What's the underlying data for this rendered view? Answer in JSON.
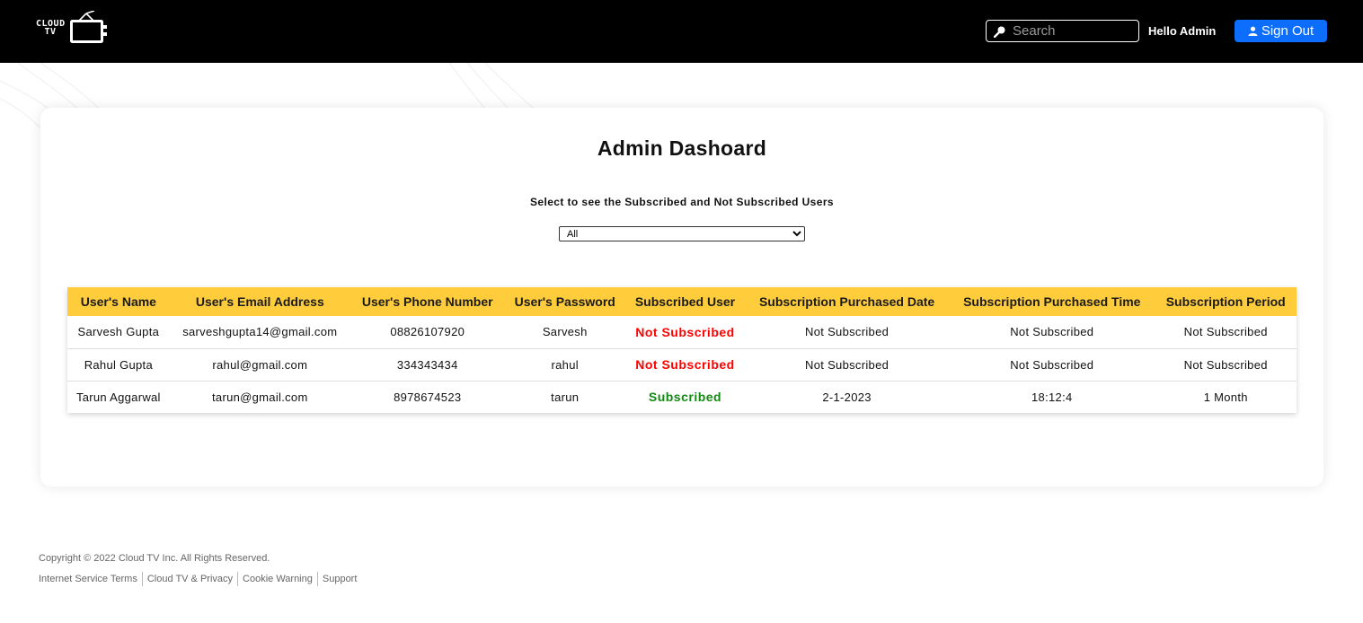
{
  "header": {
    "logo_text_top": "CLOUD",
    "logo_text_bottom": "TV",
    "search_placeholder": "Search",
    "greeting": "Hello Admin",
    "signout_label": "Sign Out"
  },
  "main": {
    "title": "Admin Dashoard",
    "subtitle": "Select to see the Subscribed and Not Subscribed Users",
    "filter_selected": "All"
  },
  "table": {
    "columns": [
      "User's Name",
      "User's Email Address",
      "User's Phone Number",
      "User's Password",
      "Subscribed User",
      "Subscription Purchased Date",
      "Subscription Purchased Time",
      "Subscription Period"
    ],
    "rows": [
      {
        "name": "Sarvesh Gupta",
        "email": "sarveshgupta14@gmail.com",
        "phone": "08826107920",
        "password": "Sarvesh",
        "subscribed": "Not Subscribed",
        "subscribed_flag": false,
        "date": "Not Subscribed",
        "time": "Not Subscribed",
        "period": "Not Subscribed"
      },
      {
        "name": "Rahul Gupta",
        "email": "rahul@gmail.com",
        "phone": "334343434",
        "password": "rahul",
        "subscribed": "Not Subscribed",
        "subscribed_flag": false,
        "date": "Not Subscribed",
        "time": "Not Subscribed",
        "period": "Not Subscribed"
      },
      {
        "name": "Tarun Aggarwal",
        "email": "tarun@gmail.com",
        "phone": "8978674523",
        "password": "tarun",
        "subscribed": "Subscribed",
        "subscribed_flag": true,
        "date": "2-1-2023",
        "time": "18:12:4",
        "period": "1 Month"
      }
    ]
  },
  "footer": {
    "copyright": "Copyright © 2022 Cloud TV Inc. All Rights Reserved.",
    "links": [
      "Internet Service Terms",
      "Cloud TV & Privacy",
      "Cookie Warning",
      "Support"
    ]
  },
  "colors": {
    "header_bg": "#000000",
    "accent_blue": "#0d6efd",
    "table_header_bg": "#ffcd3c",
    "status_not_subscribed": "#ff0000",
    "status_subscribed": "#118a11"
  }
}
